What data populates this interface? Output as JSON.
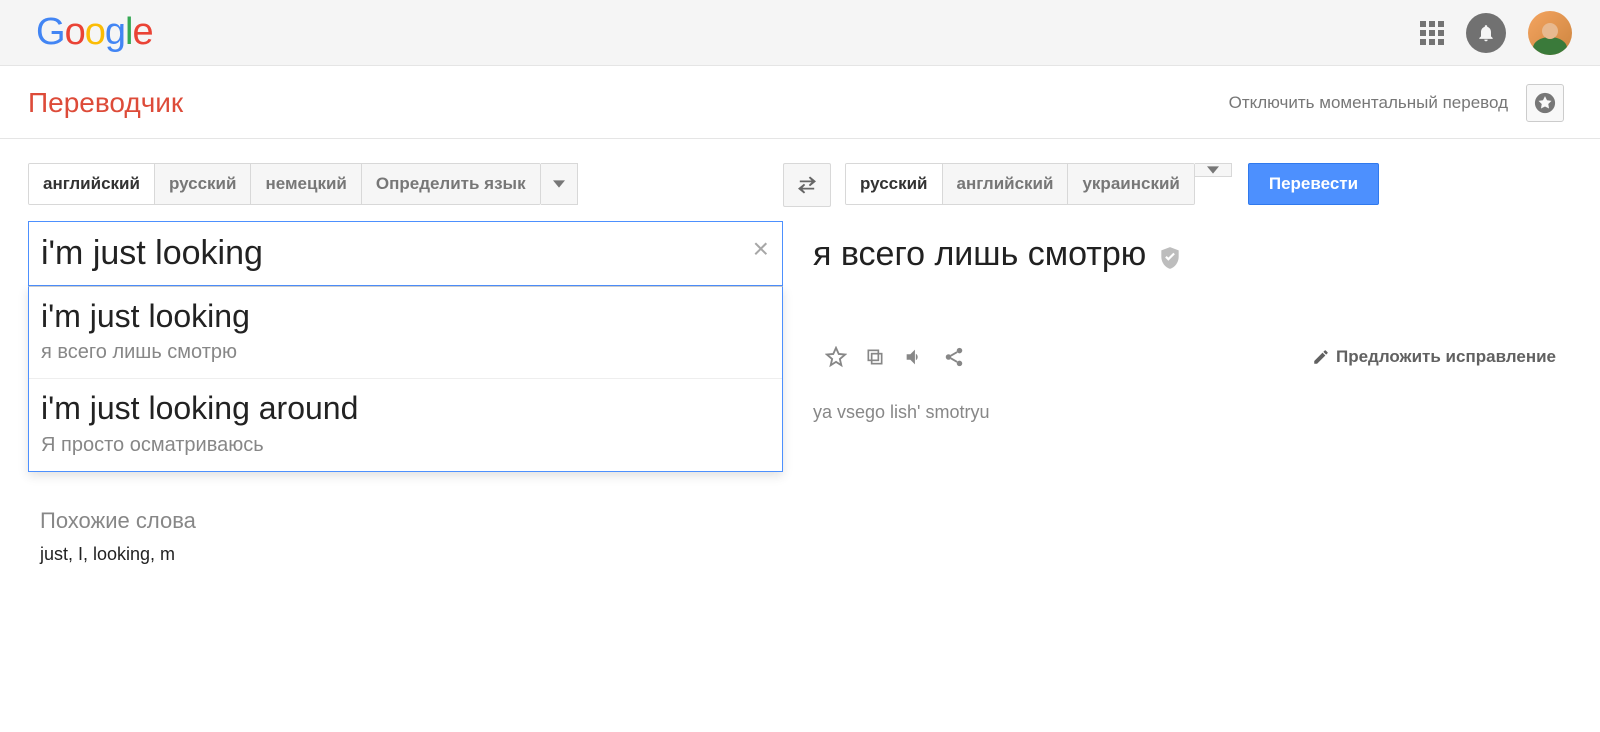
{
  "header": {
    "logo_letters": [
      "G",
      "o",
      "o",
      "g",
      "l",
      "e"
    ],
    "logo_colors": [
      "#4285F4",
      "#EA4335",
      "#FBBC05",
      "#4285F4",
      "#34A853",
      "#EA4335"
    ]
  },
  "subbar": {
    "title": "Переводчик",
    "instant_off": "Отключить моментальный перевод"
  },
  "source": {
    "tabs": [
      "английский",
      "русский",
      "немецкий",
      "Определить язык"
    ],
    "active_index": 0,
    "input_value": "i'm just looking",
    "suggestions": [
      {
        "main": "i'm just looking",
        "sub": "я всего лишь смотрю"
      },
      {
        "main": "i'm just looking around",
        "sub": "Я просто осматриваюсь"
      }
    ]
  },
  "target": {
    "tabs": [
      "русский",
      "английский",
      "украинский"
    ],
    "active_index": 0,
    "translate_button": "Перевести",
    "translation": "я всего лишь смотрю",
    "transliteration": "ya vsego lish' smotryu",
    "suggest_edit": "Предложить исправление"
  },
  "similar": {
    "heading": "Похожие слова",
    "words": "just, I, looking, m"
  }
}
